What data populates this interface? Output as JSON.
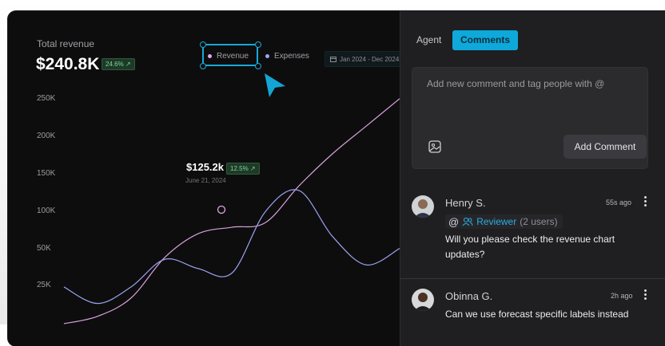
{
  "chart": {
    "title": "Total revenue",
    "total": "$240.8K",
    "total_change": "24.6% ↗",
    "legend": [
      {
        "label": "Revenue",
        "color": "#e9a6e8"
      },
      {
        "label": "Expenses",
        "color": "#9ea6f5"
      }
    ],
    "date_range": "Jan 2024 - Dec 2024",
    "point": {
      "value": "$125.2k",
      "change": "12.5% ↗",
      "date": "June 21, 2024"
    }
  },
  "chart_data": {
    "type": "line",
    "title": "Total revenue",
    "yticks": [
      "250K",
      "200K",
      "150K",
      "100K",
      "50K",
      "25K"
    ],
    "ylim": [
      0,
      275000
    ],
    "series": [
      {
        "name": "Revenue",
        "x": [
          0,
          0.1,
          0.2,
          0.3,
          0.4,
          0.5,
          0.6,
          0.7,
          0.8,
          0.9,
          1.0
        ],
        "values": [
          0,
          8000,
          28000,
          72000,
          98000,
          105000,
          110000,
          150000,
          185000,
          215000,
          245000
        ]
      },
      {
        "name": "Expenses",
        "x": [
          0,
          0.1,
          0.2,
          0.3,
          0.4,
          0.5,
          0.6,
          0.7,
          0.8,
          0.9,
          1.0
        ],
        "values": [
          40000,
          22000,
          40000,
          70000,
          60000,
          55000,
          122000,
          145000,
          95000,
          64000,
          82000
        ]
      }
    ]
  },
  "panel": {
    "tabs": [
      {
        "label": "Agent"
      },
      {
        "label": "Comments"
      }
    ],
    "comment_placeholder": "Add new comment and tag people with @",
    "add_button": "Add Comment",
    "comments": [
      {
        "name": "Henry S.",
        "time": "55s ago",
        "mention_at": "@",
        "mention_role": "Reviewer",
        "mention_count": "(2 users)",
        "text": "Will you please check the revenue chart updates?"
      },
      {
        "name": "Obinna G.",
        "time": "2h ago",
        "text": "Can we use forecast specific labels instead"
      }
    ]
  }
}
